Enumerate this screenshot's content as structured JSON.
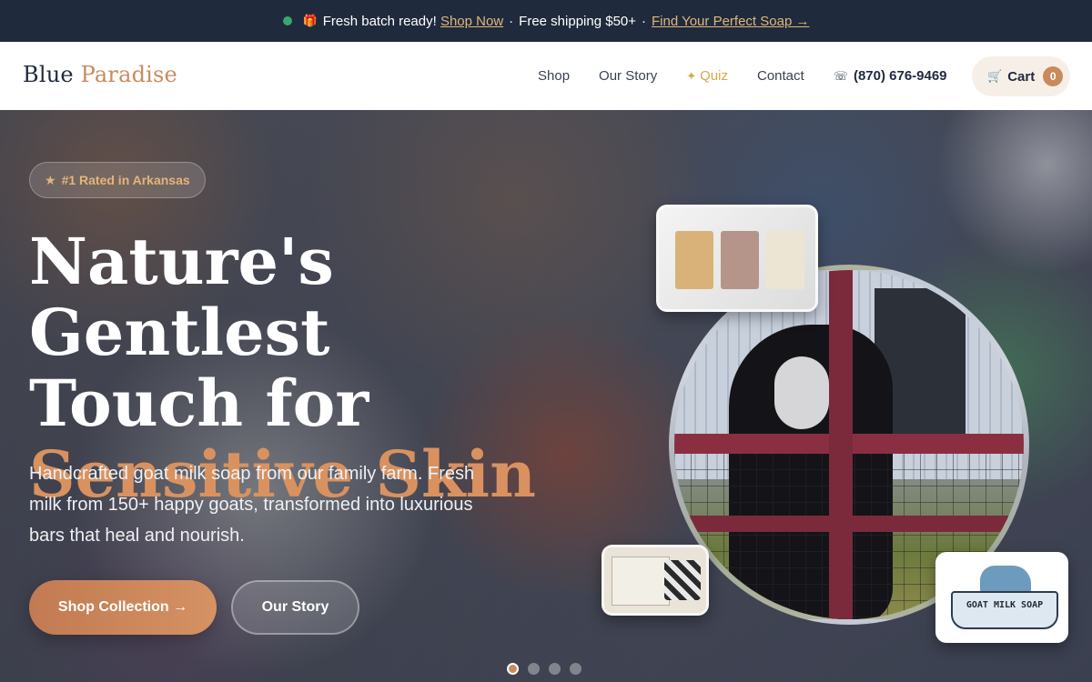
{
  "announcement": {
    "message": "Fresh batch ready!",
    "shop_link": "Shop Now",
    "separator1": "·",
    "shipping": "Free shipping $50+",
    "separator2": "·",
    "quiz_link": "Find Your Perfect Soap →",
    "gift_icon": "gift-icon"
  },
  "header": {
    "logo_part1": "Blue",
    "logo_part2": "Paradise",
    "nav": {
      "shop": "Shop",
      "story": "Our Story",
      "quiz": "Quiz",
      "contact": "Contact"
    },
    "phone": "(870) 676-9469",
    "cart_label": "Cart",
    "cart_count": "0"
  },
  "hero": {
    "badge": "#1 Rated in Arkansas",
    "headline_line1": "Nature's Gentlest",
    "headline_line2": "Touch for",
    "headline_line3": "Sensitive Skin",
    "subtext": "Handcrafted goat milk soap from our family farm. Fresh milk from 150+ happy goats, transformed into luxurious bars that heal and nourish.",
    "primary_button": "Shop Collection →",
    "secondary_button": "Our Story",
    "logo_thumb_text": "GOAT MILK SOAP",
    "carousel_active": 1,
    "carousel_total": 4
  },
  "colors": {
    "navy": "#1f2a3c",
    "accent": "#c98a5e",
    "gold": "#e2b57a",
    "status_green": "#3aa76d"
  }
}
